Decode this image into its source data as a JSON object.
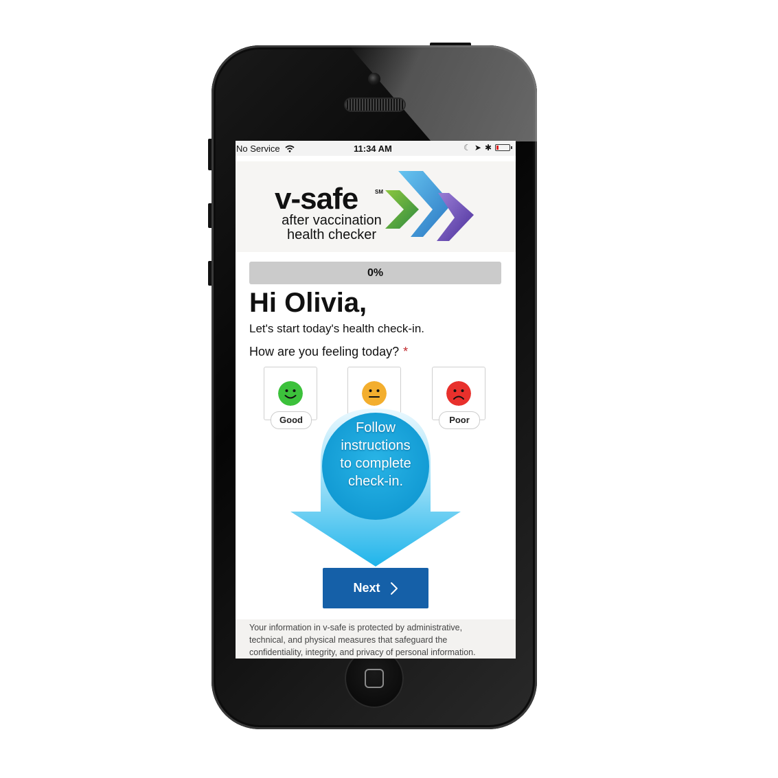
{
  "status_bar": {
    "carrier": "No Service",
    "time": "11:34 AM",
    "battery_color": "#e02020"
  },
  "header": {
    "logo_text": "v-safe",
    "logo_mark": "SM",
    "logo_subtitle_line1": "after vaccination",
    "logo_subtitle_line2": "health checker",
    "chevron_colors": [
      "#3a9b3d",
      "#2f8fd8",
      "#6a49b5"
    ]
  },
  "progress": {
    "label": "0%",
    "value": 0
  },
  "greeting": "Hi Olivia,",
  "subtitle": "Let's start today's health check-in.",
  "question": {
    "text": "How are you feeling today?",
    "required_mark": "*"
  },
  "moods": [
    {
      "label": "Good",
      "color": "#3cc13b",
      "icon": "smile-face-icon"
    },
    {
      "label": "",
      "color": "#f3ae2e",
      "icon": "neutral-face-icon"
    },
    {
      "label": "Poor",
      "color": "#e8302c",
      "icon": "frown-face-icon"
    }
  ],
  "callout": {
    "line1": "Follow",
    "line2": "instructions",
    "line3": "to complete",
    "line4": "check-in."
  },
  "next_button": {
    "label": "Next"
  },
  "footer": {
    "line1": "Your information in v-safe is protected by administrative,",
    "line2": "technical, and physical measures that safeguard the",
    "line3": "confidentiality, integrity, and privacy of personal information."
  },
  "colors": {
    "primary_button": "#1560a8",
    "arrow": "#2bb8e8"
  }
}
